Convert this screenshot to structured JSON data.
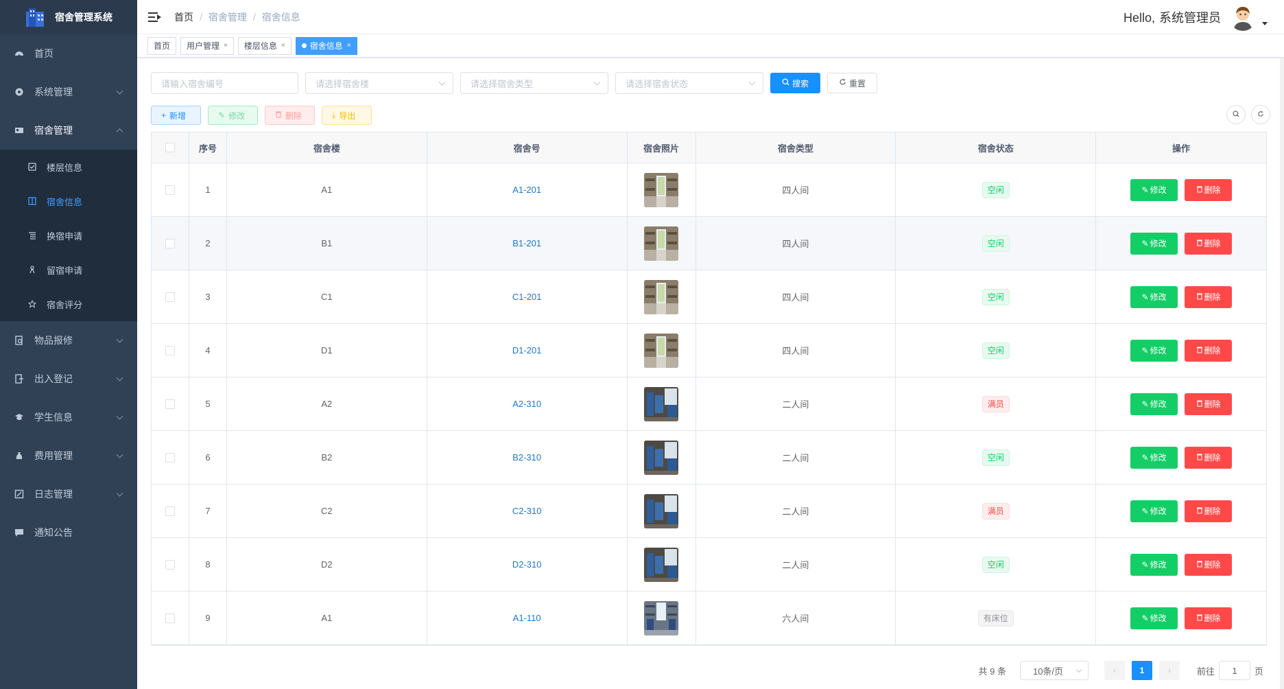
{
  "app": {
    "title": "宿舍管理系统"
  },
  "sidebar": {
    "items": [
      {
        "label": "首页",
        "icon": "dashboard-icon"
      },
      {
        "label": "系统管理",
        "icon": "gear-icon"
      },
      {
        "label": "宿舍管理",
        "icon": "building-icon"
      },
      {
        "label": "物品报修",
        "icon": "repair-icon"
      },
      {
        "label": "出入登记",
        "icon": "door-icon"
      },
      {
        "label": "学生信息",
        "icon": "student-icon"
      },
      {
        "label": "费用管理",
        "icon": "money-icon"
      },
      {
        "label": "日志管理",
        "icon": "log-icon"
      },
      {
        "label": "通知公告",
        "icon": "message-icon"
      }
    ],
    "sub_items": [
      {
        "label": "楼层信息",
        "icon": "checkbox-icon"
      },
      {
        "label": "宿舍信息",
        "icon": "columns-icon"
      },
      {
        "label": "换宿申请",
        "icon": "list-icon"
      },
      {
        "label": "留宿申请",
        "icon": "person-icon"
      },
      {
        "label": "宿舍评分",
        "icon": "star-icon"
      }
    ]
  },
  "header": {
    "breadcrumb": [
      "首页",
      "宿舍管理",
      "宿舍信息"
    ],
    "sep": "/",
    "greeting": "Hello,",
    "username": "系统管理员"
  },
  "tags": {
    "items": [
      {
        "label": "首页"
      },
      {
        "label": "用户管理"
      },
      {
        "label": "楼层信息"
      },
      {
        "label": "宿舍信息"
      }
    ],
    "close": "×"
  },
  "filters": {
    "room_no_placeholder": "请输入宿舍编号",
    "building_placeholder": "请选择宿舍楼",
    "type_placeholder": "请选择宿舍类型",
    "status_placeholder": "请选择宿舍状态",
    "search_label": "搜索",
    "reset_label": "重置"
  },
  "toolbar": {
    "add": "新增",
    "edit": "修改",
    "delete": "删除",
    "export": "导出"
  },
  "table": {
    "columns": [
      "序号",
      "宿舍楼",
      "宿舍号",
      "宿舍照片",
      "宿舍类型",
      "宿舍状态",
      "操作"
    ],
    "edit_label": "修改",
    "delete_label": "删除",
    "rows": [
      {
        "no": "1",
        "building": "A1",
        "room": "A1-201",
        "type": "四人间",
        "status": "空闲",
        "status_kind": "free",
        "photo": "four"
      },
      {
        "no": "2",
        "building": "B1",
        "room": "B1-201",
        "type": "四人间",
        "status": "空闲",
        "status_kind": "free",
        "photo": "four"
      },
      {
        "no": "3",
        "building": "C1",
        "room": "C1-201",
        "type": "四人间",
        "status": "空闲",
        "status_kind": "free",
        "photo": "four"
      },
      {
        "no": "4",
        "building": "D1",
        "room": "D1-201",
        "type": "四人间",
        "status": "空闲",
        "status_kind": "free",
        "photo": "four"
      },
      {
        "no": "5",
        "building": "A2",
        "room": "A2-310",
        "type": "二人间",
        "status": "满员",
        "status_kind": "full",
        "photo": "two"
      },
      {
        "no": "6",
        "building": "B2",
        "room": "B2-310",
        "type": "二人间",
        "status": "空闲",
        "status_kind": "free",
        "photo": "two"
      },
      {
        "no": "7",
        "building": "C2",
        "room": "C2-310",
        "type": "二人间",
        "status": "满员",
        "status_kind": "full",
        "photo": "two"
      },
      {
        "no": "8",
        "building": "D2",
        "room": "D2-310",
        "type": "二人间",
        "status": "空闲",
        "status_kind": "free",
        "photo": "two"
      },
      {
        "no": "9",
        "building": "A1",
        "room": "A1-110",
        "type": "六人间",
        "status": "有床位",
        "status_kind": "bed",
        "photo": "six"
      }
    ]
  },
  "pagination": {
    "total": "共 9 条",
    "page_size": "10条/页",
    "current": "1",
    "goto_prefix": "前往",
    "goto_value": "1",
    "goto_suffix": "页"
  },
  "colors": {
    "sidebar_bg": "#304156",
    "submenu_bg": "#1f2d3d",
    "accent": "#1890ff",
    "success": "#13ce66",
    "danger": "#ff4949"
  }
}
